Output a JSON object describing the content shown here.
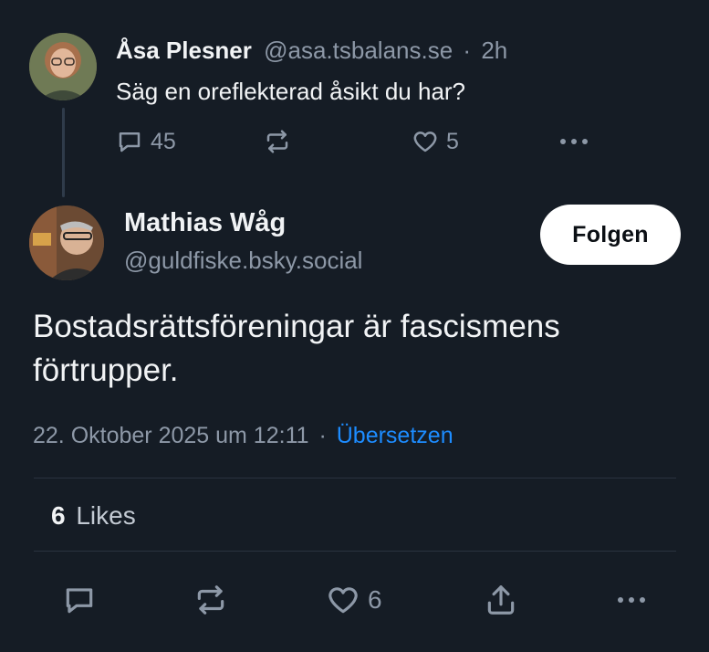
{
  "parent_post": {
    "author_name": "Åsa Plesner",
    "handle": "@asa.tsbalans.se",
    "dot": "·",
    "time": "2h",
    "text": "Säg en oreflekterad åsikt du har?",
    "replies": "45",
    "likes": "5",
    "icons": [
      "reply-icon",
      "repost-icon",
      "heart-icon",
      "more-icon"
    ]
  },
  "main_post": {
    "author_name": "Mathias Wåg",
    "handle": "@guldfiske.bsky.social",
    "follow_label": "Folgen",
    "text_line1": "Bostadsrättsföreningar är fascismens",
    "text_line2": "förtrupper.",
    "timestamp": "22. Oktober 2025 um 12:11",
    "dot": "·",
    "translate_label": "Übersetzen",
    "likes_count": "6",
    "likes_label": "Likes",
    "action_like_count": "6",
    "icons": [
      "reply-icon",
      "repost-icon",
      "heart-icon",
      "share-icon",
      "more-icon"
    ]
  },
  "colors": {
    "background": "#151c25",
    "text": "#f1f3f5",
    "muted": "#8d98a7",
    "link": "#1d8cff",
    "button_bg": "#ffffff"
  }
}
